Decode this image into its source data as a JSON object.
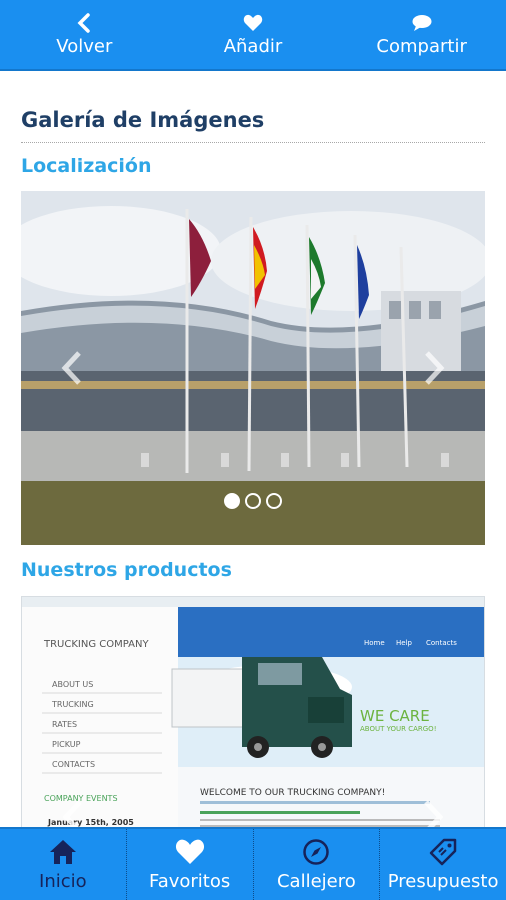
{
  "topbar": {
    "back_label": "Volver",
    "add_label": "Añadir",
    "share_label": "Compartir"
  },
  "page": {
    "title": "Galería de Imágenes"
  },
  "sections": [
    {
      "title": "Localización",
      "slides_count": 3,
      "active_slide": 1
    },
    {
      "title": "Nuestros productos"
    }
  ],
  "product_image": {
    "company": "TRUCKING COMPANY",
    "menu": [
      "ABOUT US",
      "TRUCKING",
      "RATES",
      "PICKUP",
      "CONTACTS"
    ],
    "nav": [
      "Home",
      "Help",
      "Contacts"
    ],
    "we_care": "WE CARE",
    "about_cargo": "ABOUT YOUR CARGO!",
    "welcome": "WELCOME TO OUR TRUCKING COMPANY!",
    "events": "COMPANY EVENTS",
    "date": "January 15th, 2005"
  },
  "bottombar": {
    "items": [
      {
        "label": "Inicio",
        "icon": "home-icon"
      },
      {
        "label": "Favoritos",
        "icon": "heart-icon"
      },
      {
        "label": "Callejero",
        "icon": "compass-icon"
      },
      {
        "label": "Presupuesto",
        "icon": "tag-icon"
      }
    ]
  },
  "colors": {
    "bar": "#1a8ff0",
    "title": "#1f3f66",
    "section": "#2ea6e6",
    "active_tab": "#16235a"
  }
}
